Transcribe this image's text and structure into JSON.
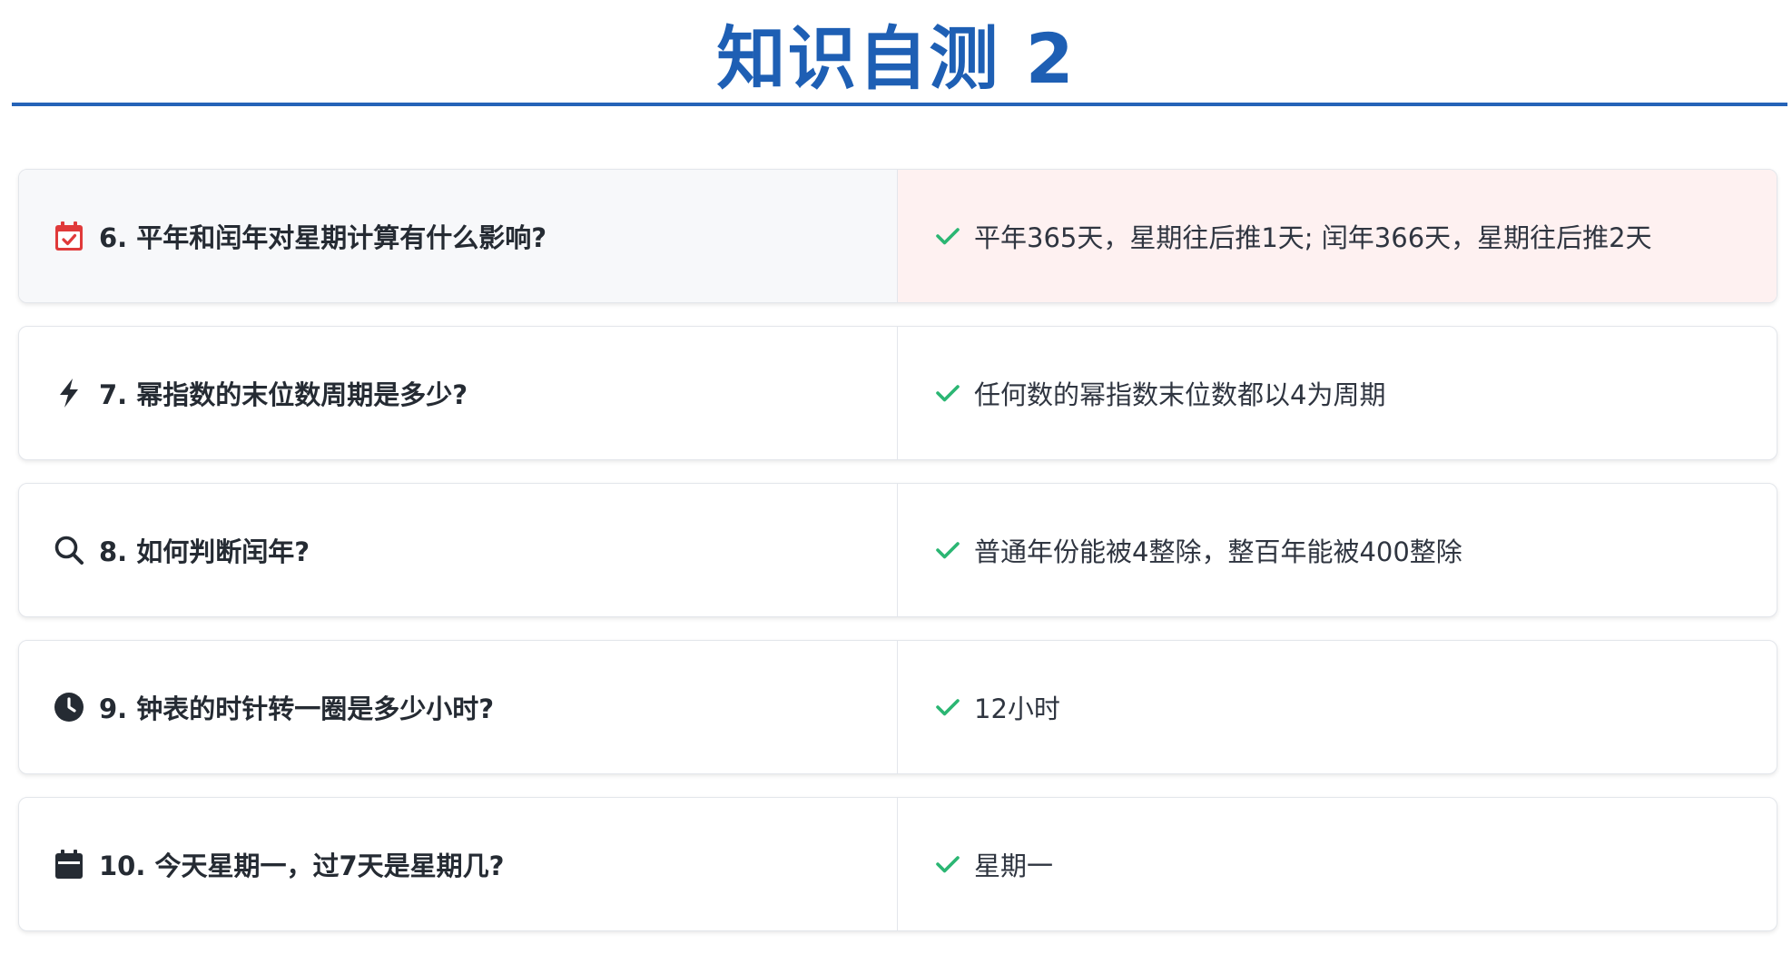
{
  "page": {
    "title": "知识自测 2"
  },
  "items": [
    {
      "question": "6. 平年和闰年对星期计算有什么影响?",
      "answer": "平年365天，星期往后推1天; 闰年366天，星期往后推2天",
      "icon": "calendar-check-icon",
      "icon_color": "#e03a3a",
      "highlighted": true
    },
    {
      "question": "7. 幂指数的末位数周期是多少?",
      "answer": "任何数的幂指数末位数都以4为周期",
      "icon": "lightning-bolt-icon",
      "icon_color": "#252b33",
      "highlighted": false
    },
    {
      "question": "8. 如何判断闰年?",
      "answer": "普通年份能被4整除，整百年能被400整除",
      "icon": "search-icon",
      "icon_color": "#252b33",
      "highlighted": false
    },
    {
      "question": "9. 钟表的时针转一圈是多少小时?",
      "answer": "12小时",
      "icon": "clock-icon",
      "icon_color": "#252b33",
      "highlighted": false
    },
    {
      "question": "10. 今天星期一，过7天是星期几?",
      "answer": "星期一",
      "icon": "calendar-icon",
      "icon_color": "#252b33",
      "highlighted": false
    }
  ],
  "colors": {
    "title": "#1e5fb4",
    "rule": "#2563b8",
    "check": "#2bb673",
    "highlight_question_bg": "#f7f8fa",
    "highlight_answer_bg": "#fef1f1"
  }
}
